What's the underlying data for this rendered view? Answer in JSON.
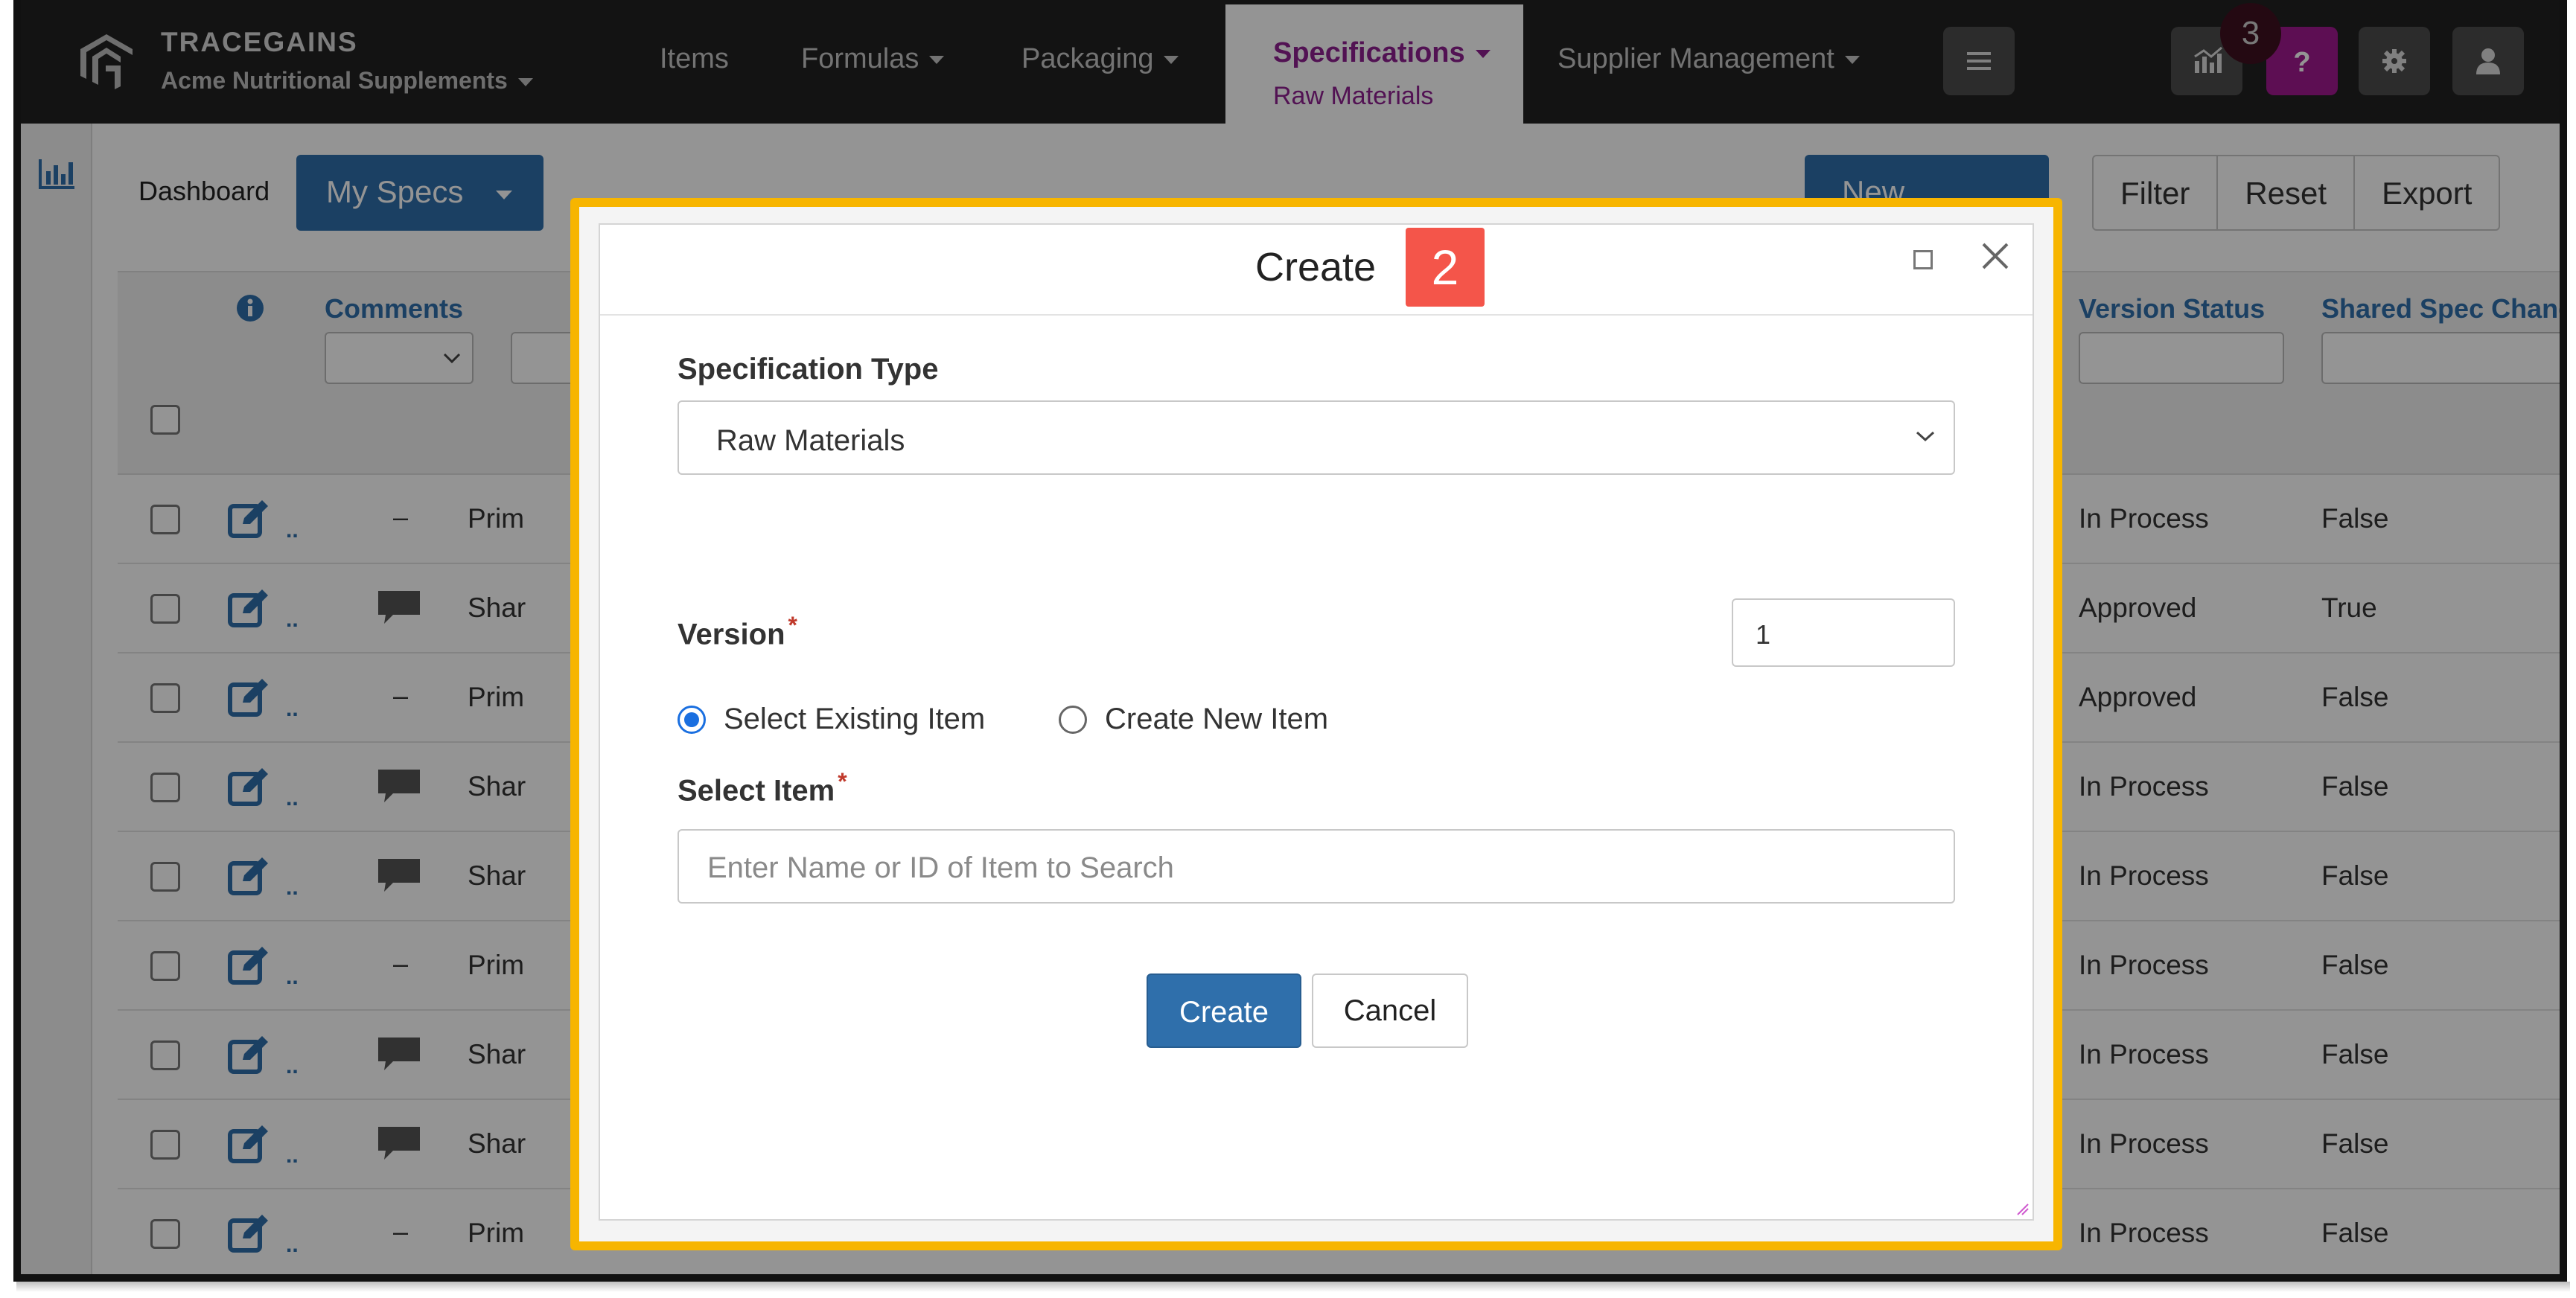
{
  "navbar": {
    "brand": "TRACEGAINS",
    "org": "Acme Nutritional Supplements",
    "links": {
      "items": "Items",
      "formulas": "Formulas",
      "packaging": "Packaging",
      "supplier_management": "Supplier Management"
    },
    "active": {
      "title": "Specifications",
      "subtitle": "Raw Materials"
    },
    "notification_count": "3",
    "icons": [
      "chart-icon",
      "help-icon",
      "gear-icon",
      "user-icon",
      "menu-icon"
    ],
    "help_color": "#a0198f",
    "active_color": "#8e1f8f"
  },
  "toolbar": {
    "dashboard": "Dashboard",
    "my_specs": "My Specs",
    "new": "New",
    "filter": "Filter",
    "reset": "Reset",
    "export": "Export"
  },
  "table": {
    "columns": {
      "comments": "Comments",
      "version_status": "Version Status",
      "shared_spec_change": "Shared Spec Chang"
    },
    "rows": [
      {
        "type": "Prim",
        "status": "In Process",
        "shared": "False",
        "comment": "–"
      },
      {
        "type": "Shar",
        "status": "Approved",
        "shared": "True",
        "comment": "icon"
      },
      {
        "type": "Prim",
        "status": "Approved",
        "shared": "False",
        "comment": "–"
      },
      {
        "type": "Shar",
        "status": "In Process",
        "shared": "False",
        "comment": "icon"
      },
      {
        "type": "Shar",
        "status": "In Process",
        "shared": "False",
        "comment": "icon"
      },
      {
        "type": "Prim",
        "status": "In Process",
        "shared": "False",
        "comment": "–"
      },
      {
        "type": "Shar",
        "status": "In Process",
        "shared": "False",
        "comment": "icon"
      },
      {
        "type": "Shar",
        "status": "In Process",
        "shared": "False",
        "comment": "icon"
      },
      {
        "type": "Prim",
        "status": "In Process",
        "shared": "False",
        "comment": "–"
      }
    ]
  },
  "modal": {
    "title": "Create",
    "step_badge": "2",
    "spec_type_label": "Specification Type",
    "spec_type_value": "Raw Materials",
    "version_label": "Version",
    "version_value": "1",
    "required_marker": "*",
    "radio_existing": "Select Existing Item",
    "radio_new": "Create New Item",
    "selected_radio": "Select Existing Item",
    "select_item_label": "Select Item",
    "search_placeholder": "Enter Name or ID of Item to Search",
    "create_button": "Create",
    "cancel_button": "Cancel",
    "highlight_color": "#f7b500",
    "badge_color": "#f4554a"
  }
}
